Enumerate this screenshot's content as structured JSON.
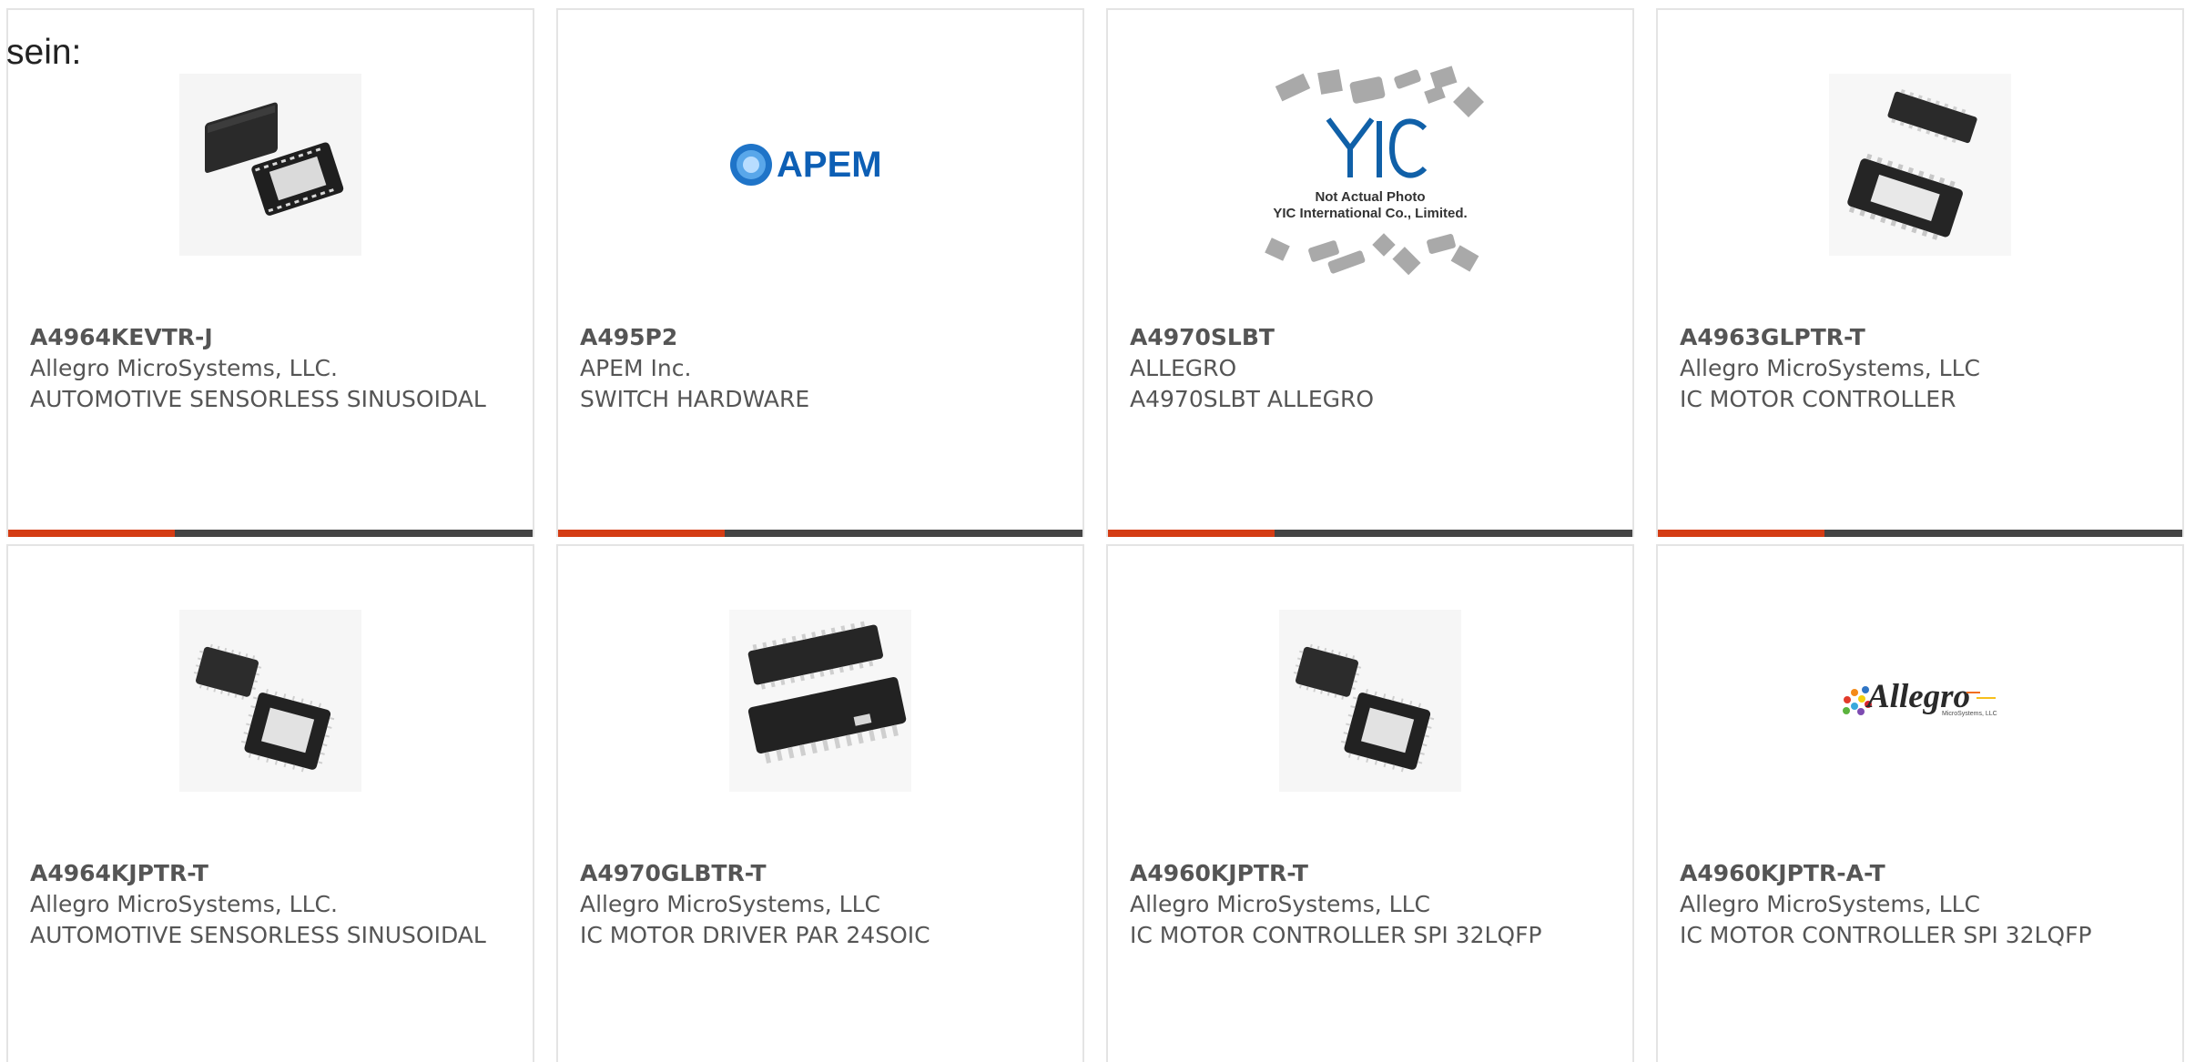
{
  "intro": {
    "text": "sein:"
  },
  "products": [
    {
      "part": "A4964KEVTR-J",
      "manufacturer": "Allegro MicroSystems, LLC.",
      "description": "AUTOMOTIVE SENSORLESS SINUSOIDAL",
      "image": "qfn-chip-pair",
      "accent": "#d43c14"
    },
    {
      "part": "A495P2",
      "manufacturer": "APEM Inc.",
      "description": "SWITCH HARDWARE",
      "image": "apem-logo",
      "logo_text": "APEM",
      "accent": "#d43c14"
    },
    {
      "part": "A4970SLBT",
      "manufacturer": "ALLEGRO",
      "description": "A4970SLBT ALLEGRO",
      "image": "yic-placeholder-collage",
      "logo_text": "YIC",
      "caption_line1": "Not Actual Photo",
      "caption_line2": "YIC International Co., Limited.",
      "accent": "#d43c14"
    },
    {
      "part": "A4963GLPTR-T",
      "manufacturer": "Allegro MicroSystems, LLC",
      "description": "IC MOTOR CONTROLLER",
      "image": "tssop-chip-pair",
      "accent": "#d43c14"
    },
    {
      "part": "A4964KJPTR-T",
      "manufacturer": "Allegro MicroSystems, LLC.",
      "description": "AUTOMOTIVE SENSORLESS SINUSOIDAL",
      "image": "lqfp-chip-pair",
      "accent": "#d43c14"
    },
    {
      "part": "A4970GLBTR-T",
      "manufacturer": "Allegro MicroSystems, LLC",
      "description": "IC MOTOR DRIVER PAR 24SOIC",
      "image": "soic-chip-pair",
      "accent": "#d43c14"
    },
    {
      "part": "A4960KJPTR-T",
      "manufacturer": "Allegro MicroSystems, LLC",
      "description": "IC MOTOR CONTROLLER SPI 32LQFP",
      "image": "lqfp-chip-pair",
      "accent": "#d43c14"
    },
    {
      "part": "A4960KJPTR-A-T",
      "manufacturer": "Allegro MicroSystems, LLC",
      "description": "IC MOTOR CONTROLLER SPI 32LQFP",
      "image": "allegro-logo",
      "logo_text": "Allegro",
      "logo_subtext": "MicroSystems, LLC",
      "accent": "#d43c14"
    }
  ],
  "colors": {
    "accent": "#d43c14",
    "footer_base": "#444444",
    "card_border": "#e4e4e4",
    "text": "#555555"
  }
}
